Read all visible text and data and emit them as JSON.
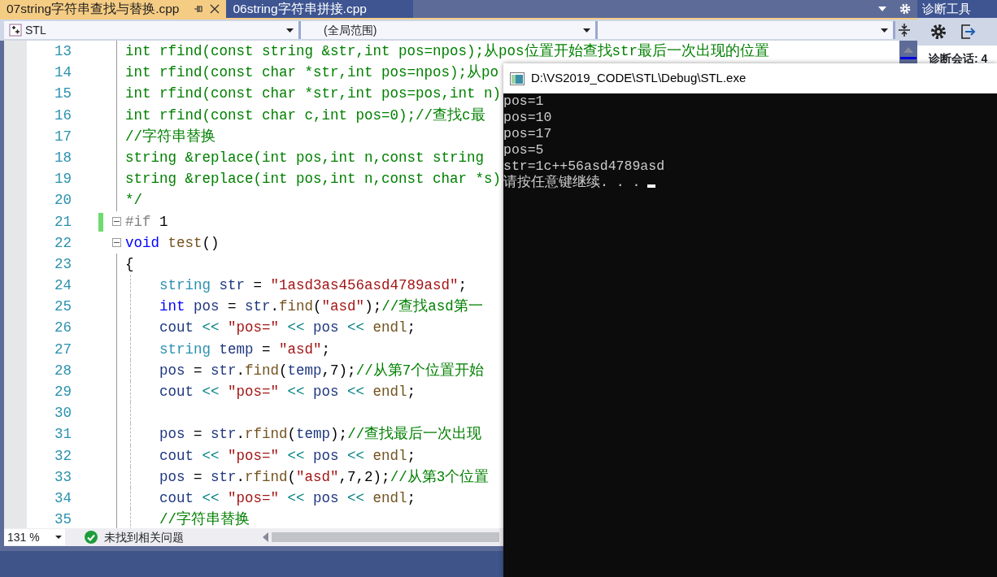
{
  "tabs": [
    {
      "label": "07string字符串查找与替换.cpp",
      "selected": true
    },
    {
      "label": "06string字符串拼接.cpp",
      "selected": false
    }
  ],
  "navigation": {
    "project": "STL",
    "scope": "(全局范围)"
  },
  "editor": {
    "lines": [
      {
        "number": "13",
        "fold": false,
        "changed": false,
        "tokens": [
          {
            "kind": "comment",
            "text": "int rfind(const string &str,int pos=npos);从pos位置开始查找str最后一次出现的位置"
          }
        ]
      },
      {
        "number": "14",
        "fold": false,
        "changed": false,
        "tokens": [
          {
            "kind": "comment",
            "text": "int rfind(const char *str,int pos=npos);从po"
          }
        ]
      },
      {
        "number": "15",
        "fold": false,
        "changed": false,
        "tokens": [
          {
            "kind": "comment",
            "text": "int rfind(const char *str,int pos=pos,int n)"
          }
        ]
      },
      {
        "number": "16",
        "fold": false,
        "changed": false,
        "tokens": [
          {
            "kind": "comment",
            "text": "int rfind(const char c,int pos=0);//查找c最"
          }
        ]
      },
      {
        "number": "17",
        "fold": false,
        "changed": false,
        "tokens": [
          {
            "kind": "comment",
            "text": "//字符串替换"
          }
        ]
      },
      {
        "number": "18",
        "fold": false,
        "changed": false,
        "tokens": [
          {
            "kind": "comment",
            "text": "string &replace(int pos,int n,const string"
          }
        ]
      },
      {
        "number": "19",
        "fold": false,
        "changed": false,
        "tokens": [
          {
            "kind": "comment",
            "text": "string &replace(int pos,int n,const char *s)"
          }
        ]
      },
      {
        "number": "20",
        "fold": false,
        "changed": false,
        "tokens": [
          {
            "kind": "comment",
            "text": "*/"
          }
        ]
      },
      {
        "number": "21",
        "fold": true,
        "changed": true,
        "tokens": [
          {
            "kind": "preproc",
            "text": "#if"
          },
          {
            "kind": "punct",
            "text": " 1"
          }
        ]
      },
      {
        "number": "22",
        "fold": true,
        "changed": false,
        "tokens": [
          {
            "kind": "keyword",
            "text": "void"
          },
          {
            "kind": "func",
            "text": " test"
          },
          {
            "kind": "punct",
            "text": "()"
          }
        ]
      },
      {
        "number": "23",
        "fold": false,
        "changed": false,
        "tokens": [
          {
            "kind": "punct",
            "text": "{"
          }
        ],
        "children": [
          {
            "number": "24",
            "fold": false,
            "changed": false,
            "tokens": [
              {
                "kind": "type",
                "text": "string"
              },
              {
                "kind": "var",
                "text": " str"
              },
              {
                "kind": "punct",
                "text": " = "
              },
              {
                "kind": "string",
                "text": "\"1asd3as456asd4789asd\""
              },
              {
                "kind": "punct",
                "text": ";"
              }
            ]
          },
          {
            "number": "25",
            "fold": false,
            "changed": false,
            "tokens": [
              {
                "kind": "keyword",
                "text": "int"
              },
              {
                "kind": "var",
                "text": " pos"
              },
              {
                "kind": "punct",
                "text": " = "
              },
              {
                "kind": "var",
                "text": "str"
              },
              {
                "kind": "punct",
                "text": "."
              },
              {
                "kind": "func",
                "text": "find"
              },
              {
                "kind": "punct",
                "text": "("
              },
              {
                "kind": "string",
                "text": "\"asd\""
              },
              {
                "kind": "punct",
                "text": ");"
              },
              {
                "kind": "comment",
                "text": "//查找asd第一"
              }
            ]
          },
          {
            "number": "26",
            "fold": false,
            "changed": false,
            "tokens": [
              {
                "kind": "var",
                "text": "cout"
              },
              {
                "kind": "op",
                "text": " << "
              },
              {
                "kind": "string",
                "text": "\"pos=\""
              },
              {
                "kind": "op",
                "text": " << "
              },
              {
                "kind": "var",
                "text": "pos"
              },
              {
                "kind": "op",
                "text": " << "
              },
              {
                "kind": "func",
                "text": "endl"
              },
              {
                "kind": "punct",
                "text": ";"
              }
            ]
          },
          {
            "number": "27",
            "fold": false,
            "changed": false,
            "tokens": [
              {
                "kind": "type",
                "text": "string"
              },
              {
                "kind": "var",
                "text": " temp"
              },
              {
                "kind": "punct",
                "text": " = "
              },
              {
                "kind": "string",
                "text": "\"asd\""
              },
              {
                "kind": "punct",
                "text": ";"
              }
            ]
          },
          {
            "number": "28",
            "fold": false,
            "changed": false,
            "tokens": [
              {
                "kind": "var",
                "text": "pos"
              },
              {
                "kind": "punct",
                "text": " = "
              },
              {
                "kind": "var",
                "text": "str"
              },
              {
                "kind": "punct",
                "text": "."
              },
              {
                "kind": "func",
                "text": "find"
              },
              {
                "kind": "punct",
                "text": "("
              },
              {
                "kind": "var",
                "text": "temp"
              },
              {
                "kind": "punct",
                "text": ",7);"
              },
              {
                "kind": "comment",
                "text": "//从第7个位置开始"
              }
            ]
          },
          {
            "number": "29",
            "fold": false,
            "changed": false,
            "tokens": [
              {
                "kind": "var",
                "text": "cout"
              },
              {
                "kind": "op",
                "text": " << "
              },
              {
                "kind": "string",
                "text": "\"pos=\""
              },
              {
                "kind": "op",
                "text": " << "
              },
              {
                "kind": "var",
                "text": "pos"
              },
              {
                "kind": "op",
                "text": " << "
              },
              {
                "kind": "func",
                "text": "endl"
              },
              {
                "kind": "punct",
                "text": ";"
              }
            ]
          },
          {
            "number": "30",
            "fold": false,
            "changed": false
          },
          {
            "number": "31",
            "fold": false,
            "changed": false,
            "tokens": [
              {
                "kind": "var",
                "text": "pos"
              },
              {
                "kind": "punct",
                "text": " = "
              },
              {
                "kind": "var",
                "text": "str"
              },
              {
                "kind": "punct",
                "text": "."
              },
              {
                "kind": "func",
                "text": "rfind"
              },
              {
                "kind": "punct",
                "text": "("
              },
              {
                "kind": "var",
                "text": "temp"
              },
              {
                "kind": "punct",
                "text": ");"
              },
              {
                "kind": "comment",
                "text": "//查找最后一次出现"
              }
            ]
          },
          {
            "number": "32",
            "fold": false,
            "changed": false,
            "tokens": [
              {
                "kind": "var",
                "text": "cout"
              },
              {
                "kind": "op",
                "text": " << "
              },
              {
                "kind": "string",
                "text": "\"pos=\""
              },
              {
                "kind": "op",
                "text": " << "
              },
              {
                "kind": "var",
                "text": "pos"
              },
              {
                "kind": "op",
                "text": " << "
              },
              {
                "kind": "func",
                "text": "endl"
              },
              {
                "kind": "punct",
                "text": ";"
              }
            ]
          },
          {
            "number": "33",
            "fold": false,
            "changed": false,
            "tokens": [
              {
                "kind": "var",
                "text": "pos"
              },
              {
                "kind": "punct",
                "text": " = "
              },
              {
                "kind": "var",
                "text": "str"
              },
              {
                "kind": "punct",
                "text": "."
              },
              {
                "kind": "func",
                "text": "rfind"
              },
              {
                "kind": "punct",
                "text": "("
              },
              {
                "kind": "string",
                "text": "\"asd\""
              },
              {
                "kind": "punct",
                "text": ",7,2);"
              },
              {
                "kind": "comment",
                "text": "//从第3个位置"
              }
            ]
          },
          {
            "number": "34",
            "fold": false,
            "changed": false,
            "tokens": [
              {
                "kind": "var",
                "text": "cout"
              },
              {
                "kind": "op",
                "text": " << "
              },
              {
                "kind": "string",
                "text": "\"pos=\""
              },
              {
                "kind": "op",
                "text": " << "
              },
              {
                "kind": "var",
                "text": "pos"
              },
              {
                "kind": "op",
                "text": " << "
              },
              {
                "kind": "func",
                "text": "endl"
              },
              {
                "kind": "punct",
                "text": ";"
              }
            ]
          },
          {
            "number": "35",
            "fold": false,
            "changed": false,
            "tokens": [
              {
                "kind": "comment",
                "text": "//字符串替换"
              }
            ]
          }
        ]
      }
    ]
  },
  "status_bar": {
    "zoom": "131 %",
    "issues": "未找到相关问题"
  },
  "diagnostics": {
    "title": "诊断工具",
    "session": "诊断会话: 4"
  },
  "console": {
    "title": "D:\\VS2019_CODE\\STL\\Debug\\STL.exe",
    "lines": [
      "pos=1",
      "pos=10",
      "pos=17",
      "pos=5",
      "str=1c++56asd4789asd",
      "请按任意键继续. . ."
    ]
  }
}
